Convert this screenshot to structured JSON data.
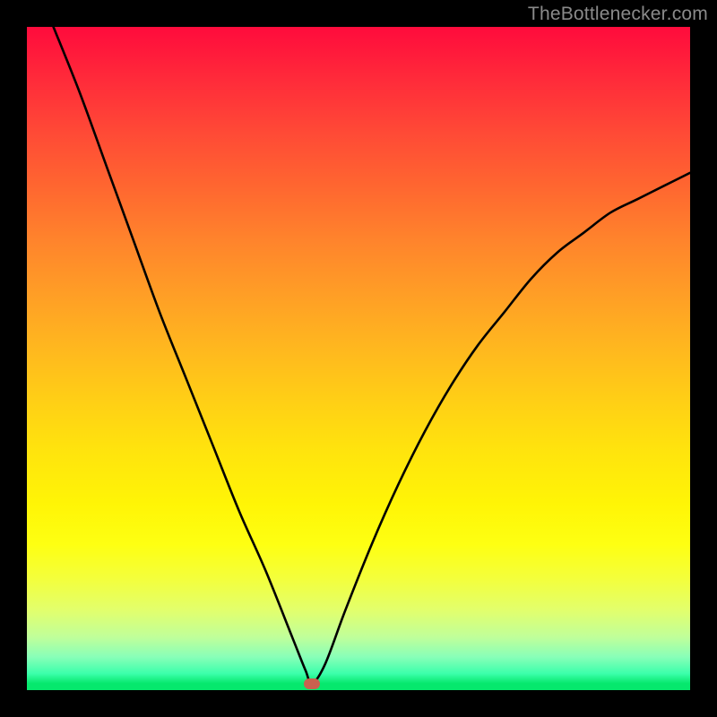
{
  "watermark": "TheBottlenecker.com",
  "chart_data": {
    "type": "line",
    "title": "",
    "xlabel": "",
    "ylabel": "",
    "xlim": [
      0,
      100
    ],
    "ylim": [
      0,
      100
    ],
    "grid": false,
    "legend": false,
    "background_gradient": {
      "top": "#ff0b3c",
      "bottom": "#06e86d",
      "meaning": "worse-to-better"
    },
    "minimum_marker": {
      "x": 43,
      "y": 1,
      "color": "#c9604f"
    },
    "series": [
      {
        "name": "left-branch",
        "x": [
          4,
          8,
          12,
          16,
          20,
          24,
          28,
          32,
          36,
          40,
          42,
          43
        ],
        "values": [
          100,
          90,
          79,
          68,
          57,
          47,
          37,
          27,
          18,
          8,
          3,
          1
        ]
      },
      {
        "name": "right-branch",
        "x": [
          43,
          45,
          48,
          52,
          56,
          60,
          64,
          68,
          72,
          76,
          80,
          84,
          88,
          92,
          96,
          100
        ],
        "values": [
          1,
          4,
          12,
          22,
          31,
          39,
          46,
          52,
          57,
          62,
          66,
          69,
          72,
          74,
          76,
          78
        ]
      }
    ]
  }
}
